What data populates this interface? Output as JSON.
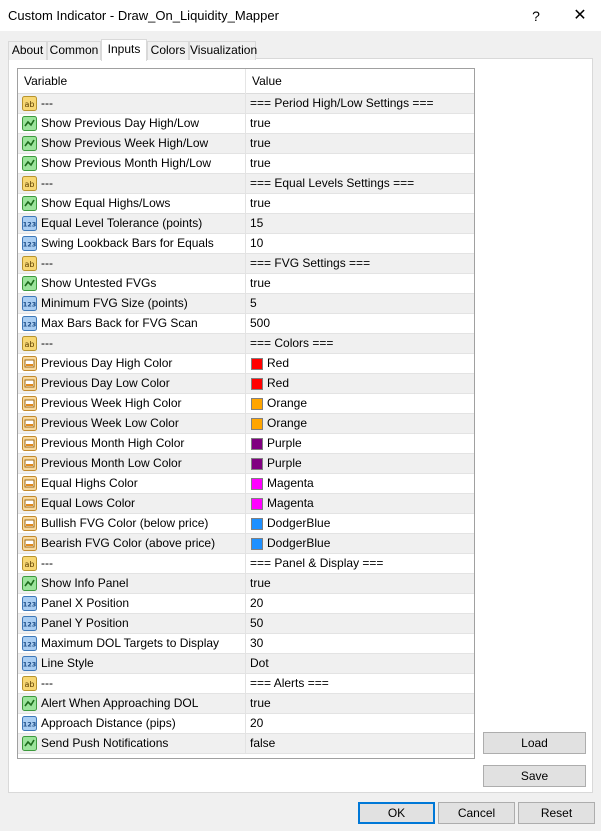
{
  "window": {
    "title": "Custom Indicator - Draw_On_Liquidity_Mapper",
    "help_glyph": "?",
    "close_glyph": "✕"
  },
  "tabs": [
    {
      "label": "About"
    },
    {
      "label": "Common"
    },
    {
      "label": "Inputs",
      "active": true
    },
    {
      "label": "Colors"
    },
    {
      "label": "Visualization"
    }
  ],
  "grid": {
    "headers": {
      "variable": "Variable",
      "value": "Value"
    },
    "rows": [
      {
        "icon": "ab-icon",
        "name": "---",
        "value": "=== Period High/Low Settings ==="
      },
      {
        "icon": "bool-icon",
        "name": "Show Previous Day High/Low",
        "value": "true"
      },
      {
        "icon": "bool-icon",
        "name": "Show Previous Week High/Low",
        "value": "true"
      },
      {
        "icon": "bool-icon",
        "name": "Show Previous Month High/Low",
        "value": "true"
      },
      {
        "icon": "ab-icon",
        "name": "---",
        "value": "=== Equal Levels Settings ==="
      },
      {
        "icon": "bool-icon",
        "name": "Show Equal Highs/Lows",
        "value": "true"
      },
      {
        "icon": "num-icon",
        "name": "Equal Level Tolerance (points)",
        "value": "15"
      },
      {
        "icon": "num-icon",
        "name": "Swing Lookback Bars for Equals",
        "value": "10"
      },
      {
        "icon": "ab-icon",
        "name": "---",
        "value": "=== FVG Settings ==="
      },
      {
        "icon": "bool-icon",
        "name": "Show Untested FVGs",
        "value": "true"
      },
      {
        "icon": "num-icon",
        "name": "Minimum FVG Size (points)",
        "value": "5"
      },
      {
        "icon": "num-icon",
        "name": "Max Bars Back for FVG Scan",
        "value": "500"
      },
      {
        "icon": "ab-icon",
        "name": "---",
        "value": "=== Colors ==="
      },
      {
        "icon": "color-icon",
        "name": "Previous Day High Color",
        "value": "Red",
        "swatch": "#ff0000"
      },
      {
        "icon": "color-icon",
        "name": "Previous Day Low Color",
        "value": "Red",
        "swatch": "#ff0000"
      },
      {
        "icon": "color-icon",
        "name": "Previous Week High Color",
        "value": "Orange",
        "swatch": "#ffa500"
      },
      {
        "icon": "color-icon",
        "name": "Previous Week Low Color",
        "value": "Orange",
        "swatch": "#ffa500"
      },
      {
        "icon": "color-icon",
        "name": "Previous Month High Color",
        "value": "Purple",
        "swatch": "#800080"
      },
      {
        "icon": "color-icon",
        "name": "Previous Month Low Color",
        "value": "Purple",
        "swatch": "#800080"
      },
      {
        "icon": "color-icon",
        "name": "Equal Highs Color",
        "value": "Magenta",
        "swatch": "#ff00ff"
      },
      {
        "icon": "color-icon",
        "name": "Equal Lows Color",
        "value": "Magenta",
        "swatch": "#ff00ff"
      },
      {
        "icon": "color-icon",
        "name": "Bullish FVG Color (below price)",
        "value": "DodgerBlue",
        "swatch": "#1e90ff"
      },
      {
        "icon": "color-icon",
        "name": "Bearish FVG Color (above price)",
        "value": "DodgerBlue",
        "swatch": "#1e90ff"
      },
      {
        "icon": "ab-icon",
        "name": "---",
        "value": "=== Panel & Display ==="
      },
      {
        "icon": "bool-icon",
        "name": "Show Info Panel",
        "value": "true"
      },
      {
        "icon": "num-icon",
        "name": "Panel X Position",
        "value": "20"
      },
      {
        "icon": "num-icon",
        "name": "Panel Y Position",
        "value": "50"
      },
      {
        "icon": "num-icon",
        "name": "Maximum DOL Targets to Display",
        "value": "30"
      },
      {
        "icon": "num-icon",
        "name": "Line Style",
        "value": "Dot"
      },
      {
        "icon": "ab-icon",
        "name": "---",
        "value": "=== Alerts ==="
      },
      {
        "icon": "bool-icon",
        "name": "Alert When Approaching DOL",
        "value": "true"
      },
      {
        "icon": "num-icon",
        "name": "Approach Distance (pips)",
        "value": "20"
      },
      {
        "icon": "bool-icon",
        "name": "Send Push Notifications",
        "value": "false"
      }
    ]
  },
  "buttons": {
    "load": "Load",
    "save": "Save",
    "ok": "OK",
    "cancel": "Cancel",
    "reset": "Reset"
  },
  "colors": {
    "accent": "#0078d7",
    "row_alt": "#f0f0f0",
    "grid_border": "#a0a0a0"
  }
}
